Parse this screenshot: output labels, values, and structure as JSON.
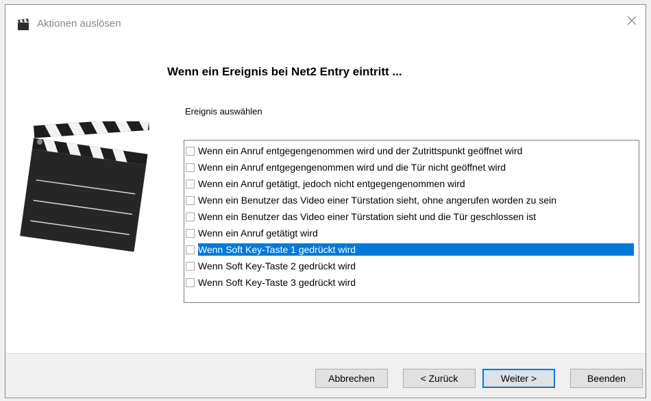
{
  "window": {
    "title": "Aktionen auslösen",
    "icon": "clapperboard-icon",
    "close_icon": "close-icon"
  },
  "heading": "Wenn ein Ereignis bei Net2 Entry eintritt ...",
  "subheading": "Ereignis auswählen",
  "events": [
    {
      "label": "Wenn ein Anruf entgegengenommen wird und der Zutrittspunkt geöffnet wird",
      "checked": false,
      "selected": false
    },
    {
      "label": "Wenn ein Anruf entgegengenommen wird und die Tür nicht geöffnet wird",
      "checked": false,
      "selected": false
    },
    {
      "label": "Wenn ein Anruf getätigt, jedoch nicht entgegengenommen wird",
      "checked": false,
      "selected": false
    },
    {
      "label": "Wenn ein Benutzer das Video einer Türstation sieht, ohne angerufen worden zu sein",
      "checked": false,
      "selected": false
    },
    {
      "label": "Wenn ein Benutzer das Video einer Türstation sieht und die Tür geschlossen ist",
      "checked": false,
      "selected": false
    },
    {
      "label": "Wenn ein Anruf getätigt wird",
      "checked": false,
      "selected": false
    },
    {
      "label": "Wenn Soft Key-Taste 1 gedrückt wird",
      "checked": false,
      "selected": true
    },
    {
      "label": "Wenn Soft Key-Taste 2 gedrückt wird",
      "checked": false,
      "selected": false
    },
    {
      "label": "Wenn Soft Key-Taste 3 gedrückt wird",
      "checked": false,
      "selected": false
    }
  ],
  "buttons": {
    "cancel": "Abbrechen",
    "back": "< Zurück",
    "next": "Weiter >",
    "finish": "Beenden"
  },
  "colors": {
    "selection": "#0078d7",
    "footer_bg": "#f0f0f0"
  }
}
